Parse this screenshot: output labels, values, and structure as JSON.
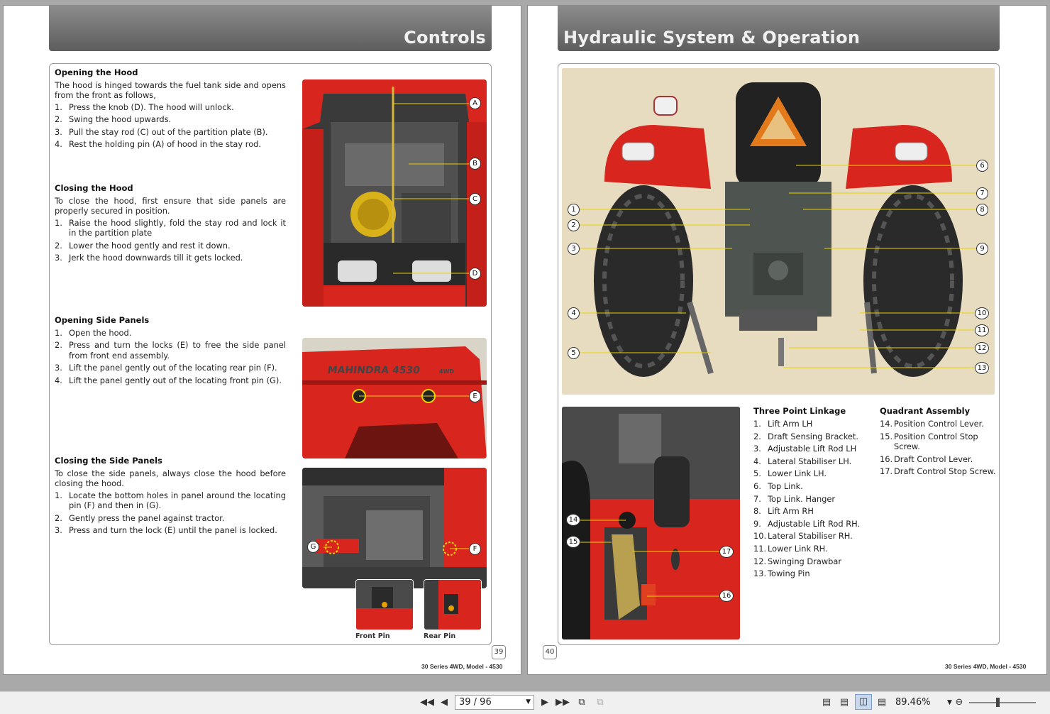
{
  "left_page": {
    "title": "Controls",
    "sections": {
      "open_hood": {
        "heading": "Opening the Hood",
        "intro": "The hood is hinged towards the fuel tank side and opens from the front as follows,",
        "steps": [
          "Press the knob (D). The hood will unlock.",
          "Swing the hood upwards.",
          "Pull the stay rod (C) out of the partition plate (B).",
          "Rest the holding pin (A) of hood in the stay rod."
        ]
      },
      "close_hood": {
        "heading": "Closing the Hood",
        "intro": "To close the hood, first ensure that side panels are properly secured in position.",
        "steps": [
          "Raise the hood slightly, fold the stay rod and lock it in the partition plate",
          "Lower the hood gently and rest it down.",
          "Jerk the hood downwards till it gets locked."
        ]
      },
      "open_panels": {
        "heading": "Opening Side Panels",
        "steps": [
          "Open the hood.",
          "Press and turn the locks (E) to free the side panel from front end assembly.",
          "Lift the panel gently out of the locating rear pin (F).",
          "Lift the panel gently out of the locating front pin (G)."
        ]
      },
      "close_panels": {
        "heading": "Closing the Side Panels",
        "intro": "To close the side panels, always close the hood before closing the hood.",
        "steps": [
          "Locate the bottom holes in panel around the locating pin (F) and then in (G).",
          "Gently press the panel against tractor.",
          "Press and turn the lock (E) until the panel is locked."
        ]
      }
    },
    "photo_labels": {
      "a": "A",
      "b": "B",
      "c": "C",
      "d": "D",
      "e": "E",
      "f": "F",
      "g": "G"
    },
    "tractor_badge": "MAHINDRA 4530",
    "tractor_badge_small": "4WD",
    "front_pin_label": "Front Pin",
    "rear_pin_label": "Rear Pin",
    "page_number": "39",
    "footer": "30 Series 4WD, Model - 4530"
  },
  "right_page": {
    "title": "Hydraulic System & Operation",
    "three_point_linkage": {
      "heading": "Three Point Linkage",
      "items": [
        {
          "num": "1.",
          "label": "Lift Arm LH"
        },
        {
          "num": "2.",
          "label": "Draft Sensing Bracket."
        },
        {
          "num": "3.",
          "label": "Adjustable Lift Rod LH"
        },
        {
          "num": "4.",
          "label": "Lateral Stabiliser LH."
        },
        {
          "num": "5.",
          "label": "Lower Link LH."
        },
        {
          "num": "6.",
          "label": "Top Link."
        },
        {
          "num": "7.",
          "label": "Top Link. Hanger"
        },
        {
          "num": "8.",
          "label": "Lift Arm RH"
        },
        {
          "num": "9.",
          "label": "Adjustable Lift Rod RH."
        },
        {
          "num": "10.",
          "label": "Lateral Stabiliser RH."
        },
        {
          "num": "11.",
          "label": "Lower Link RH."
        },
        {
          "num": "12.",
          "label": "Swinging Drawbar"
        },
        {
          "num": "13.",
          "label": "Towing Pin"
        }
      ]
    },
    "quadrant_assembly": {
      "heading": "Quadrant Assembly",
      "items": [
        {
          "num": "14.",
          "label": "Position Control Lever."
        },
        {
          "num": "15.",
          "label": "Position Control Stop Screw."
        },
        {
          "num": "16.",
          "label": "Draft Control Lever."
        },
        {
          "num": "17.",
          "label": "Draft Control Stop Screw."
        }
      ]
    },
    "callouts": {
      "c1": "1",
      "c2": "2",
      "c3": "3",
      "c4": "4",
      "c5": "5",
      "c6": "6",
      "c7": "7",
      "c8": "8",
      "c9": "9",
      "c10": "10",
      "c11": "11",
      "c12": "12",
      "c13": "13",
      "c14": "14",
      "c15": "15",
      "c16": "16",
      "c17": "17"
    },
    "page_number": "40",
    "footer": "30 Series 4WD, Model - 4530"
  },
  "viewer": {
    "page_field": "39 / 96",
    "zoom": "89.46%"
  },
  "colors": {
    "tractor_red": "#d8261f",
    "title_bar": "#6e6e6e",
    "callout_line": "#e8d200"
  }
}
